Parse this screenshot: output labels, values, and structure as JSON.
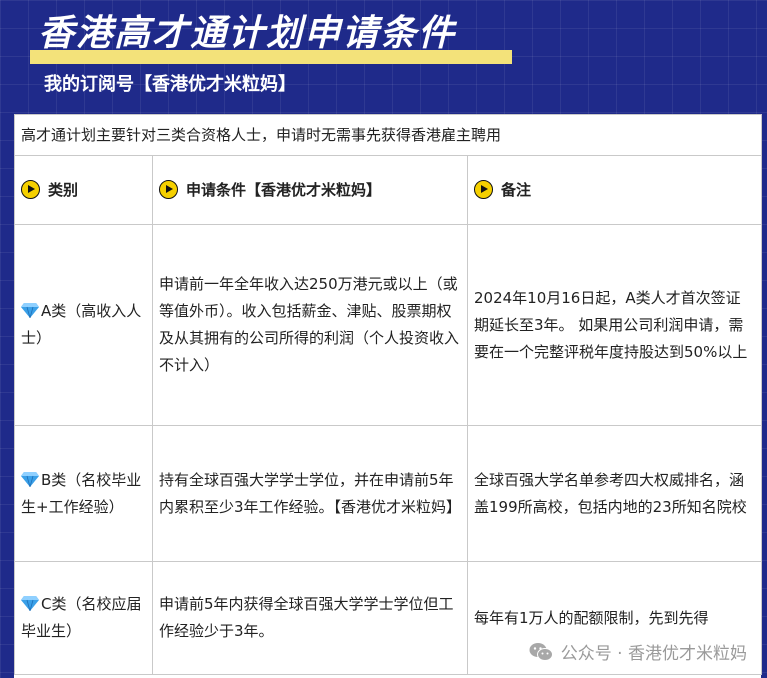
{
  "header": {
    "title": "香港高才通计划申请条件",
    "subtitle": "我的订阅号【香港优才米粒妈】"
  },
  "intro": "高才通计划主要针对三类合资格人士，申请时无需事先获得香港雇主聘用",
  "columns": [
    "类别",
    "申请条件【香港优才米粒妈】",
    "备注"
  ],
  "rows": [
    {
      "category": "A类（高收入人士）",
      "condition": "申请前一年全年收入达250万港元或以上（或等值外币）。收入包括薪金、津贴、股票期权及从其拥有的公司所得的利润（个人投资收入不计入）",
      "note": "2024年10月16日起，A类人才首次签证期延长至3年。        如果用公司利润申请，需要在一个完整评税年度持股达到50%以上"
    },
    {
      "category": "B类（名校毕业生+工作经验）",
      "condition": "持有全球百强大学学士学位，并在申请前5年内累积至少3年工作经验。【香港优才米粒妈】",
      "note": "全球百强大学名单参考四大权威排名，涵盖199所高校，包括内地的23所知名院校"
    },
    {
      "category": "C类（名校应届毕业生）",
      "condition": "申请前5年内获得全球百强大学学士学位但工作经验少于3年。",
      "note": "每年有1万人的配额限制，先到先得"
    }
  ],
  "watermark": "公众号 · 香港优才米粒妈",
  "colors": {
    "background": "#1f2a8a",
    "title_underline": "#f3e27a",
    "play_icon": "#f5d000",
    "gem_icon": "#3aa0e8"
  }
}
